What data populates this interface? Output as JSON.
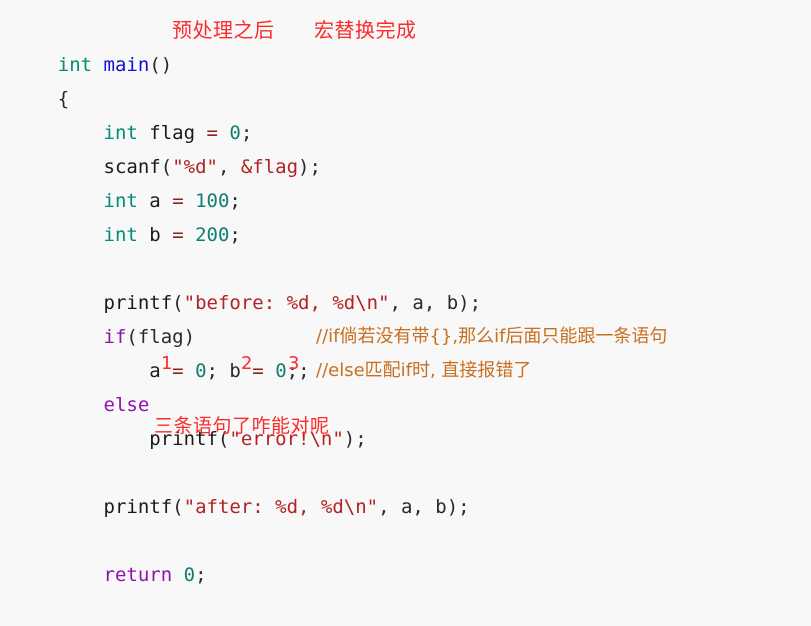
{
  "editor": {
    "background_color": "#f8f8f8",
    "language": "c",
    "colors": {
      "keyword_type": "#008b72",
      "keyword_control": "#9010b0",
      "function_name": "#1212d6",
      "string": "#b22222",
      "number": "#108070",
      "operator": "#8b2020",
      "comment": "#c87020",
      "annotation_red": "#fb2c2c",
      "plain": "#1a1a1a"
    }
  },
  "code": {
    "lines": [
      {
        "index": 1,
        "text": "int main()",
        "tokens": [
          {
            "text": "int",
            "type": "keyword_type"
          },
          {
            "text": " ",
            "type": "plain"
          },
          {
            "text": "main",
            "type": "function_name"
          },
          {
            "text": "()",
            "type": "punct"
          }
        ]
      },
      {
        "index": 2,
        "text": "{",
        "tokens": [
          {
            "text": "{",
            "type": "punct"
          }
        ]
      },
      {
        "index": 3,
        "text": "    int flag = 0;",
        "tokens": [
          {
            "text": "    ",
            "type": "plain"
          },
          {
            "text": "int",
            "type": "keyword_type"
          },
          {
            "text": " flag ",
            "type": "plain"
          },
          {
            "text": "=",
            "type": "operator"
          },
          {
            "text": " ",
            "type": "plain"
          },
          {
            "text": "0",
            "type": "number"
          },
          {
            "text": ";",
            "type": "punct"
          }
        ]
      },
      {
        "index": 4,
        "text": "    scanf(\"%d\", &flag);",
        "tokens": [
          {
            "text": "    ",
            "type": "plain"
          },
          {
            "text": "scanf",
            "type": "plain"
          },
          {
            "text": "(",
            "type": "punct"
          },
          {
            "text": "\"%d\"",
            "type": "string"
          },
          {
            "text": ", ",
            "type": "punct"
          },
          {
            "text": "&flag",
            "type": "string"
          },
          {
            "text": ");",
            "type": "punct"
          }
        ]
      },
      {
        "index": 5,
        "text": "    int a = 100;",
        "tokens": [
          {
            "text": "    ",
            "type": "plain"
          },
          {
            "text": "int",
            "type": "keyword_type"
          },
          {
            "text": " a ",
            "type": "plain"
          },
          {
            "text": "=",
            "type": "operator"
          },
          {
            "text": " ",
            "type": "plain"
          },
          {
            "text": "100",
            "type": "number"
          },
          {
            "text": ";",
            "type": "punct"
          }
        ]
      },
      {
        "index": 6,
        "text": "    int b = 200;",
        "tokens": [
          {
            "text": "    ",
            "type": "plain"
          },
          {
            "text": "int",
            "type": "keyword_type"
          },
          {
            "text": " b ",
            "type": "plain"
          },
          {
            "text": "=",
            "type": "operator"
          },
          {
            "text": " ",
            "type": "plain"
          },
          {
            "text": "200",
            "type": "number"
          },
          {
            "text": ";",
            "type": "punct"
          }
        ]
      },
      {
        "index": 7,
        "text": "",
        "tokens": []
      },
      {
        "index": 8,
        "text": "    printf(\"before: %d, %d\\n\", a, b);",
        "tokens": [
          {
            "text": "    ",
            "type": "plain"
          },
          {
            "text": "printf",
            "type": "plain"
          },
          {
            "text": "(",
            "type": "punct"
          },
          {
            "text": "\"before: %d, %d\\n\"",
            "type": "string"
          },
          {
            "text": ", a, b);",
            "type": "punct"
          }
        ]
      },
      {
        "index": 9,
        "text": "    if(flag)",
        "tokens": [
          {
            "text": "    ",
            "type": "plain"
          },
          {
            "text": "if",
            "type": "keyword_control"
          },
          {
            "text": "(flag)",
            "type": "punct"
          }
        ]
      },
      {
        "index": 10,
        "text": "        a = 0; b = 0;; //if倘若没有带{},那么if后面只能跟一条语句",
        "tokens": [
          {
            "text": "        a ",
            "type": "plain"
          },
          {
            "text": "=",
            "type": "operator"
          },
          {
            "text": " ",
            "type": "plain"
          },
          {
            "text": "0",
            "type": "number"
          },
          {
            "text": "; b ",
            "type": "punct"
          },
          {
            "text": "=",
            "type": "operator"
          },
          {
            "text": " ",
            "type": "plain"
          },
          {
            "text": "0",
            "type": "number"
          },
          {
            "text": ";;",
            "type": "punct"
          }
        ],
        "comment": "//if倘若没有带{},那么if后面只能跟一条语句"
      },
      {
        "index": 11,
        "text": "    else //else匹配if时, 直接报错了",
        "tokens": [
          {
            "text": "    ",
            "type": "plain"
          },
          {
            "text": "else",
            "type": "keyword_control"
          }
        ],
        "comment": "//else匹配if时, 直接报错了"
      },
      {
        "index": 12,
        "text": "        printf(\"error!\\n\");",
        "tokens": [
          {
            "text": "        ",
            "type": "plain"
          },
          {
            "text": "printf",
            "type": "plain"
          },
          {
            "text": "(",
            "type": "punct"
          },
          {
            "text": "\"error!\\n\"",
            "type": "string"
          },
          {
            "text": ");",
            "type": "punct"
          }
        ]
      },
      {
        "index": 13,
        "text": "",
        "tokens": []
      },
      {
        "index": 14,
        "text": "    printf(\"after: %d, %d\\n\", a, b);",
        "tokens": [
          {
            "text": "    ",
            "type": "plain"
          },
          {
            "text": "printf",
            "type": "plain"
          },
          {
            "text": "(",
            "type": "punct"
          },
          {
            "text": "\"after: %d, %d\\n\"",
            "type": "string"
          },
          {
            "text": ", a, b);",
            "type": "punct"
          }
        ]
      },
      {
        "index": 15,
        "text": "",
        "tokens": []
      },
      {
        "index": 16,
        "text": "    return 0;",
        "tokens": [
          {
            "text": "    ",
            "type": "plain"
          },
          {
            "text": "return",
            "type": "keyword_control"
          },
          {
            "text": " ",
            "type": "plain"
          },
          {
            "text": "0",
            "type": "number"
          },
          {
            "text": ";",
            "type": "punct"
          }
        ]
      }
    ]
  },
  "annotations": {
    "header_left": "预处理之后",
    "header_right": "宏替换完成",
    "marker_1": "1",
    "marker_2": "2",
    "marker_3": "3",
    "note_three_statements": "三条语句了咋能对呢"
  }
}
